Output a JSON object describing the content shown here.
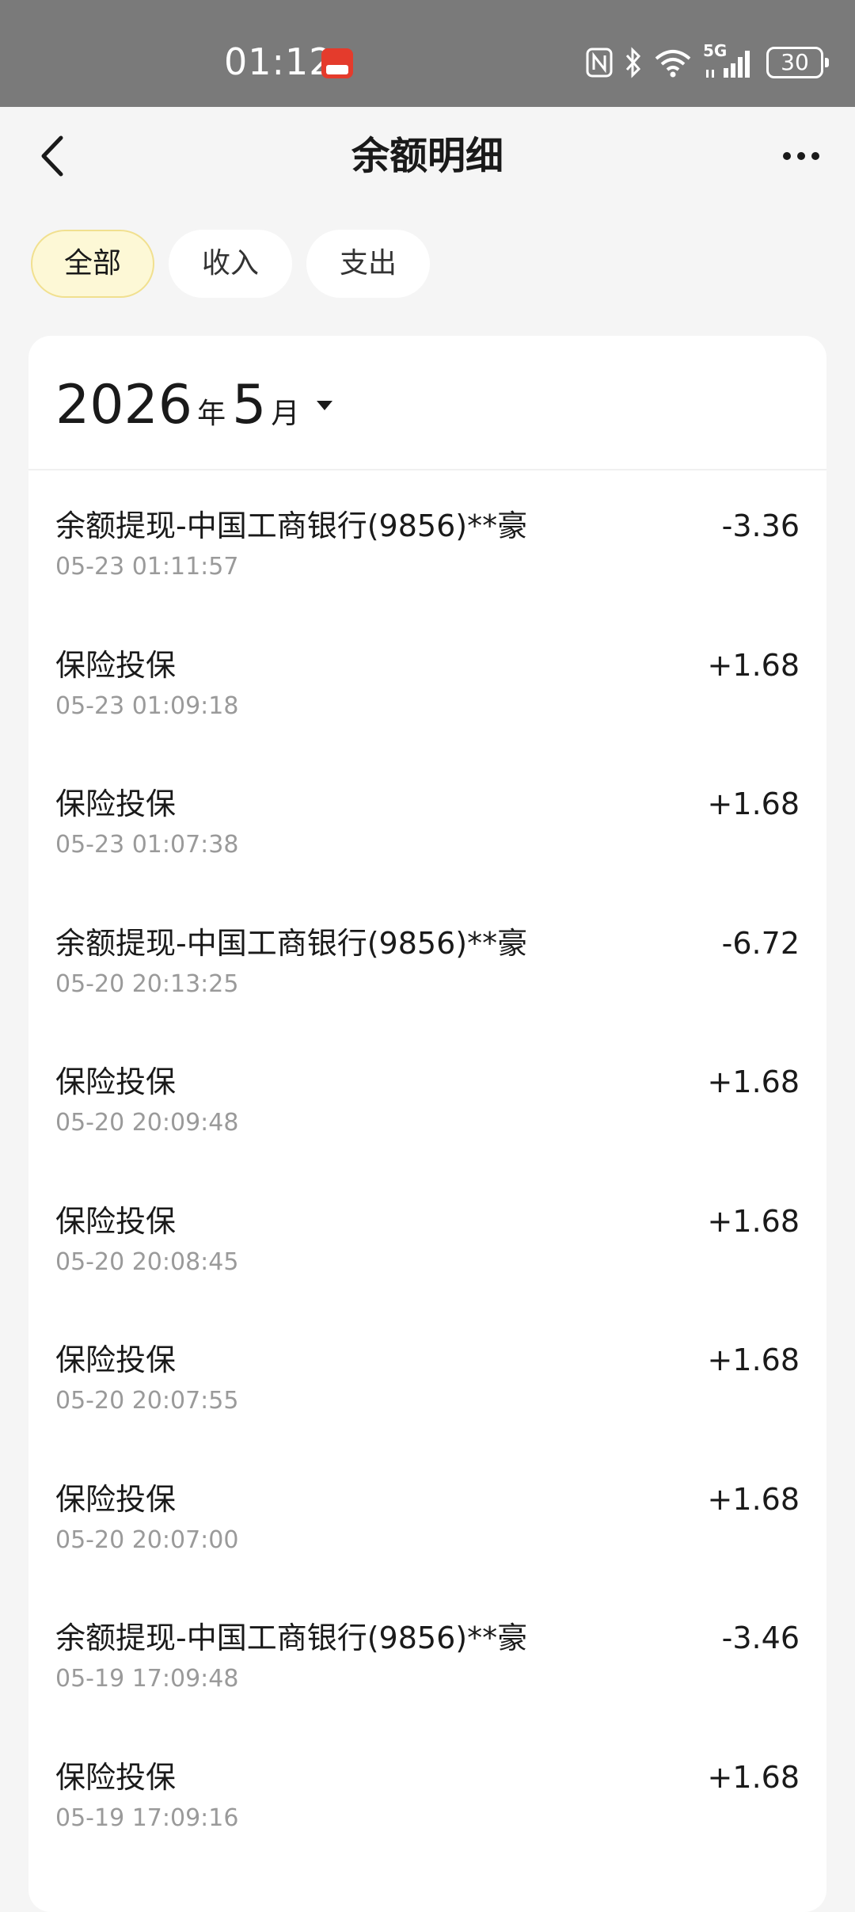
{
  "status_bar": {
    "time": "01:12",
    "app_icon": "cloud-pay-icon",
    "icons": [
      "nfc-icon",
      "bluetooth-icon",
      "wifi-icon",
      "signal-5g-icon"
    ],
    "network": "5G",
    "battery": "30"
  },
  "header": {
    "title": "余额明细",
    "back_icon": "chevron-left-icon",
    "more_icon": "more-dots-icon"
  },
  "filters": [
    {
      "label": "全部",
      "active": true
    },
    {
      "label": "收入",
      "active": false
    },
    {
      "label": "支出",
      "active": false
    }
  ],
  "month_selector": {
    "year": "2026",
    "year_unit": "年",
    "month": "5",
    "month_unit": "月"
  },
  "transactions": [
    {
      "title": "余额提现-中国工商银行(9856)**豪",
      "time": "05-23 01:11:57",
      "amount": "-3.36"
    },
    {
      "title": "保险投保",
      "time": "05-23 01:09:18",
      "amount": "+1.68"
    },
    {
      "title": "保险投保",
      "time": "05-23 01:07:38",
      "amount": "+1.68"
    },
    {
      "title": "余额提现-中国工商银行(9856)**豪",
      "time": "05-20 20:13:25",
      "amount": "-6.72"
    },
    {
      "title": "保险投保",
      "time": "05-20 20:09:48",
      "amount": "+1.68"
    },
    {
      "title": "保险投保",
      "time": "05-20 20:08:45",
      "amount": "+1.68"
    },
    {
      "title": "保险投保",
      "time": "05-20 20:07:55",
      "amount": "+1.68"
    },
    {
      "title": "保险投保",
      "time": "05-20 20:07:00",
      "amount": "+1.68"
    },
    {
      "title": "余额提现-中国工商银行(9856)**豪",
      "time": "05-19 17:09:48",
      "amount": "-3.46"
    },
    {
      "title": "保险投保",
      "time": "05-19 17:09:16",
      "amount": "+1.68"
    }
  ]
}
